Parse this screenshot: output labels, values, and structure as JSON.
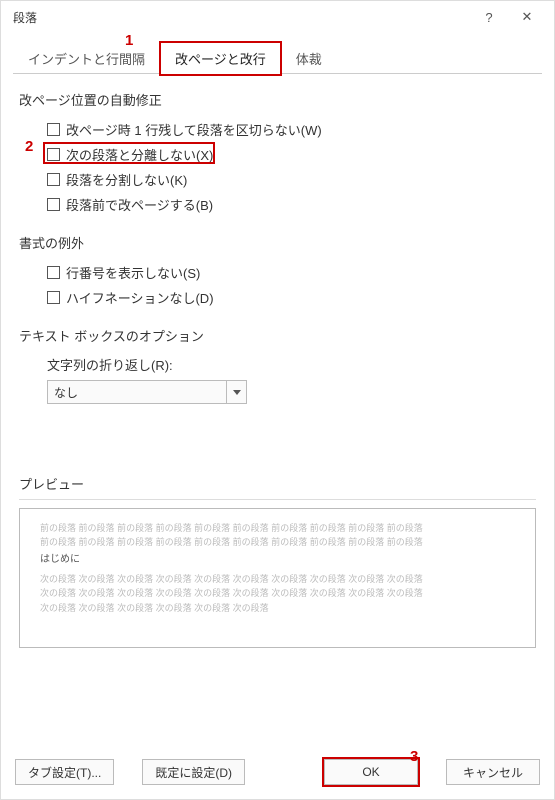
{
  "titlebar": {
    "title": "段落"
  },
  "tabs": [
    {
      "label": "インデントと行間隔"
    },
    {
      "label": "改ページと改行"
    },
    {
      "label": "体裁"
    }
  ],
  "sections": {
    "pagination": {
      "title": "改ページ位置の自動修正",
      "opts": [
        "改ページ時 1 行残して段落を区切らない(W)",
        "次の段落と分離しない(X)",
        "段落を分割しない(K)",
        "段落前で改ページする(B)"
      ]
    },
    "formatting": {
      "title": "書式の例外",
      "opts": [
        "行番号を表示しない(S)",
        "ハイフネーションなし(D)"
      ]
    },
    "textbox": {
      "title": "テキスト ボックスのオプション",
      "wrap_label": "文字列の折り返し(R):",
      "wrap_value": "なし"
    }
  },
  "preview": {
    "title": "プレビュー",
    "sample_text": "はじめに",
    "prev_para": "前の段落",
    "next_para": "次の段落"
  },
  "buttons": {
    "tab_settings": "タブ設定(T)...",
    "set_default": "既定に設定(D)",
    "ok": "OK",
    "cancel": "キャンセル"
  },
  "annotations": {
    "a1": "1",
    "a2": "2",
    "a3": "3"
  }
}
